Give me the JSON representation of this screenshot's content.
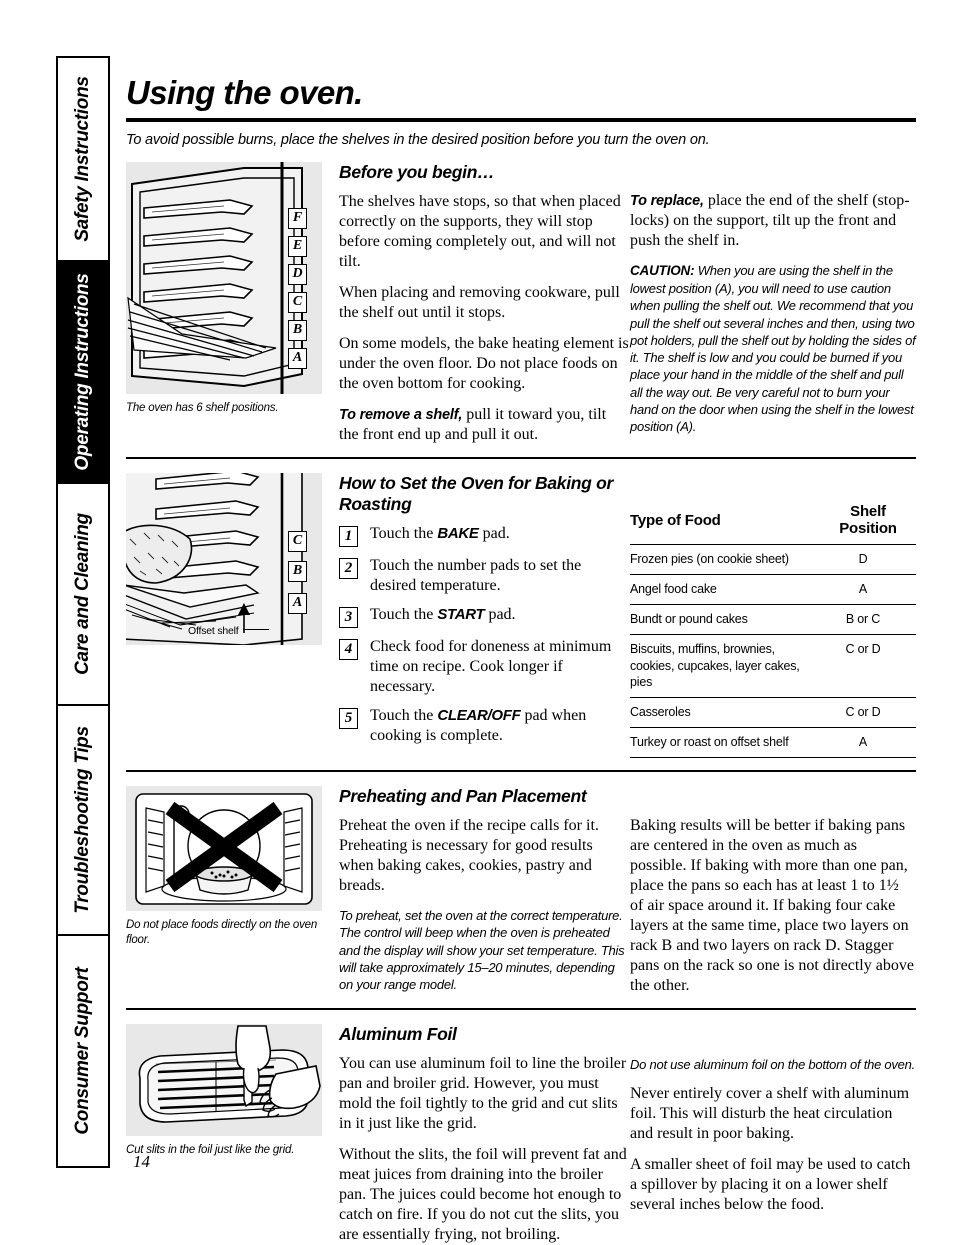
{
  "sidebar": {
    "tabs": [
      {
        "label": "Safety Instructions",
        "active": false
      },
      {
        "label": "Operating Instructions",
        "active": true
      },
      {
        "label": "Care and Cleaning",
        "active": false
      },
      {
        "label": "Troubleshooting Tips",
        "active": false
      },
      {
        "label": "Consumer Support",
        "active": false
      }
    ]
  },
  "header": {
    "title": "Using the oven.",
    "intro": "To avoid possible burns, place the shelves in the desired position before you turn the oven on."
  },
  "page_number": "14",
  "figures": {
    "shelf_positions": {
      "caption": "The oven has 6 shelf positions.",
      "letters": [
        "F",
        "E",
        "D",
        "C",
        "B",
        "A"
      ]
    },
    "offset_shelf": {
      "letters": [
        "C",
        "B",
        "A"
      ],
      "annotation": "Offset shelf"
    },
    "oven_floor": {
      "caption": "Do not place foods directly on the oven floor."
    },
    "broiler_foil": {
      "caption": "Cut slits in the foil just like the grid."
    }
  },
  "sections": {
    "before_you_begin": {
      "heading": "Before you begin…",
      "left": {
        "p1": "The shelves have stops, so that when placed correctly on the supports, they will stop before coming completely out, and will not tilt.",
        "p2": "When placing and removing cookware, pull the shelf out until it stops.",
        "p3": "On some models, the bake heating element is under the oven floor. Do not place foods on the oven bottom for cooking.",
        "p4_lead": "To remove a shelf,",
        "p4": " pull it toward you, tilt the front end up and pull it out."
      },
      "right": {
        "p1_lead": "To replace,",
        "p1": " place the end of the shelf (stop-locks) on the support, tilt up the front and push the shelf in.",
        "caution_lead": "CAUTION:",
        "caution": " When you are using the shelf in the lowest position (A), you will need to use caution when pulling the shelf out. We recommend that you pull the shelf out several inches and then, using two pot holders, pull the shelf out by holding the sides of it. The shelf is low and you could be burned if you place your hand in the middle of the shelf and pull all the way out. Be very careful not to burn your hand on the door when using the shelf in the lowest position (A)."
      }
    },
    "baking": {
      "heading": "How to Set the Oven for Baking or Roasting",
      "steps": [
        {
          "num": "1",
          "pre": "Touch the ",
          "pad": "BAKE",
          "post": " pad."
        },
        {
          "num": "2",
          "pre": "Touch the number pads to set the desired temperature.",
          "pad": "",
          "post": ""
        },
        {
          "num": "3",
          "pre": "Touch the ",
          "pad": "START",
          "post": " pad."
        },
        {
          "num": "4",
          "pre": "Check food for doneness at minimum time on recipe. Cook longer if necessary.",
          "pad": "",
          "post": ""
        },
        {
          "num": "5",
          "pre": "Touch the ",
          "pad": "CLEAR/OFF",
          "post": " pad when cooking is complete."
        }
      ],
      "table": {
        "headers": [
          "Type of Food",
          "Shelf Position"
        ],
        "rows": [
          {
            "food": "Frozen pies (on cookie sheet)",
            "position": "D"
          },
          {
            "food": "Angel food cake",
            "position": "A"
          },
          {
            "food": "Bundt or pound cakes",
            "position": "B or C"
          },
          {
            "food": "Biscuits, muffins, brownies, cookies, cupcakes, layer cakes, pies",
            "position": "C or D"
          },
          {
            "food": "Casseroles",
            "position": "C or D"
          },
          {
            "food": "Turkey or roast on offset shelf",
            "position": "A"
          }
        ]
      }
    },
    "preheating": {
      "heading": "Preheating and Pan Placement",
      "left": {
        "p1": "Preheat the oven if the recipe calls for it. Preheating is necessary for good results when baking cakes, cookies, pastry and breads.",
        "note": "To preheat, set the oven at the correct temperature. The control will beep when the oven is preheated and the display will show your set temperature. This will take approximately 15–20 minutes, depending on your range model."
      },
      "right": {
        "p1": "Baking results will be better if baking pans are centered in the oven as much as possible. If baking with more than one pan, place the pans so each has at least 1 to 1½  of air space around it. If baking four cake layers at the same time, place two layers on rack B and two layers on rack D. Stagger pans on the rack so one is not directly above the other."
      }
    },
    "aluminum_foil": {
      "heading": "Aluminum Foil",
      "left": {
        "p1": "You can use aluminum foil to line the broiler pan and broiler grid. However, you must mold the foil tightly to the grid and cut slits in it just like the grid.",
        "p2": "Without the slits, the foil will prevent fat and meat juices from draining into the broiler pan. The juices could become hot enough to catch on fire. If you do not cut the slits, you are essentially frying, not broiling."
      },
      "right": {
        "note": "Do not use aluminum foil on the bottom of the oven.",
        "p1": "Never entirely cover a shelf with aluminum foil. This will disturb the heat circulation and result in poor baking.",
        "p2": "A smaller sheet of foil may be used to catch a spillover by placing it on a lower shelf several inches below the food."
      }
    }
  }
}
